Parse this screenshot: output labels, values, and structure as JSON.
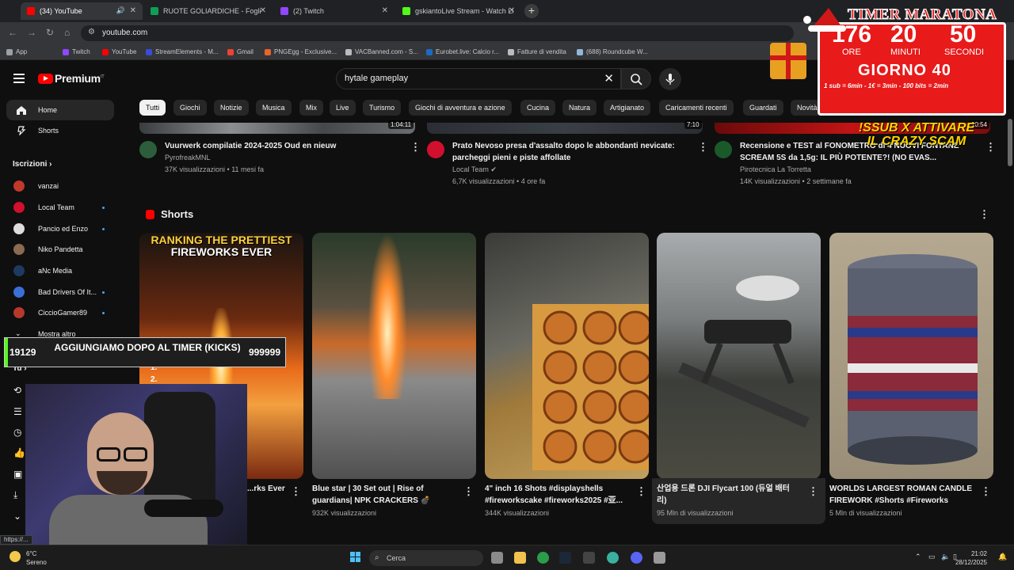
{
  "browser": {
    "tabs": [
      {
        "label": "(34) YouTube",
        "color": "#ff0000"
      },
      {
        "label": "RUOTE GOLIARDICHE - Fogli G",
        "color": "#0f9d58"
      },
      {
        "label": "(2) Twitch",
        "color": "#9146ff"
      },
      {
        "label": "gskiantoLive Stream - Watch Li",
        "color": "#53fc18"
      }
    ],
    "url": "youtube.com",
    "bookmarks": [
      "App",
      "Twitch",
      "YouTube",
      "StreamElements - M...",
      "Gmail",
      "PNGEgg - Exclusive...",
      "VACBanned.com - S...",
      "Eurobet.live: Calcio r...",
      "Fatture di vendita",
      "(688) Roundcube W..."
    ],
    "status_url": "https://..."
  },
  "youtube": {
    "brand": "Premium",
    "region": "IT",
    "search_query": "hytale gameplay",
    "chips": [
      "Tutti",
      "Giochi",
      "Notizie",
      "Musica",
      "Mix",
      "Live",
      "Turismo",
      "Giochi di avventura e azione",
      "Cucina",
      "Natura",
      "Artigianato",
      "Caricamenti recenti",
      "Guardati",
      "Novità"
    ],
    "sidebar": {
      "home": "Home",
      "shorts": "Shorts",
      "subs_header": "Iscrizioni",
      "subs": [
        {
          "name": "vanzai",
          "color": "#c0392b",
          "dot": false
        },
        {
          "name": "Local Team",
          "color": "#d10f2f",
          "dot": true
        },
        {
          "name": "Pancio ed Enzo",
          "color": "#ddd",
          "dot": true
        },
        {
          "name": "Niko Pandetta",
          "color": "#8a6a50",
          "dot": false
        },
        {
          "name": "aNc Media",
          "color": "#1e3a5f",
          "dot": false
        },
        {
          "name": "Bad Drivers Of It...",
          "color": "#3a6fd8",
          "dot": true
        },
        {
          "name": "CiccioGamer89",
          "color": "#b8382c",
          "dot": true
        }
      ],
      "show_more": "Mostra altro",
      "you": "Tu"
    },
    "videos": [
      {
        "title": "Vuurwerk compilatie 2024-2025    Oud en nieuw",
        "channel": "PyrofreakMNL",
        "meta": "37K visualizzazioni • 11 mesi fa",
        "duration": "1:04:11"
      },
      {
        "title": "Prato Nevoso presa d'assalto dopo le abbondanti nevicate: parcheggi pieni e piste affollate",
        "channel": "Local Team",
        "meta": "6,7K visualizzazioni • 4 ore fa",
        "duration": "7:10"
      },
      {
        "title": "Recensione e TEST al FONOMETRO di 4 NUOVI FONTANE SCREAM 5S da 1,5g: IL PIÙ POTENTE?! (NO EVAS...",
        "channel": "Pirotecnica La Torretta",
        "meta": "14K visualizzazioni • 2 settimane fa",
        "duration": "10:54"
      }
    ],
    "shorts_header": "Shorts",
    "shorts": [
      {
        "title": "...rks Ever",
        "views": "",
        "overlay_line1": "RANKING THE PRETTIEST",
        "overlay_line2": "FIREWORKS EVER",
        "list1": "1.",
        "list2": "2."
      },
      {
        "title": "Blue star | 30 Set out | Rise of guardians| NPK CRACKERS 💣",
        "views": "932K visualizzazioni"
      },
      {
        "title": "4\" inch 16 Shots #displayshells #fireworkscake #fireworks2025 #亚...",
        "views": "344K visualizzazioni"
      },
      {
        "title": "산업용 드론 DJI Flycart 100 (듀얼 배터리)",
        "views": "95 Mln di visualizzazioni"
      },
      {
        "title": "WORLDS LARGEST ROMAN CANDLE FIREWORK #Shorts #Fireworks",
        "views": "5 Mln di visualizzazioni"
      }
    ]
  },
  "overlay": {
    "timer_title": "TIMER MARATONA",
    "hours": "176",
    "minutes": "20",
    "seconds": "50",
    "hours_label": "ORE",
    "minutes_label": "MINUTI",
    "seconds_label": "SECONDI",
    "day": "GIORNO 40",
    "rules": "1 sub = 6min - 1€ = 3min - 100 bits = 2min",
    "sub_alert": "!SSUB X ATTIVARE IL CRAZY SCAM",
    "kick_left": "19129",
    "kick_text": "AGGIUNGIAMO DOPO AL TIMER (KICKS)",
    "kick_right": "999999"
  },
  "taskbar": {
    "temp": "6°C",
    "weather": "Sereno",
    "search": "Cerca",
    "time": "21:02",
    "date": "28/12/2025"
  }
}
